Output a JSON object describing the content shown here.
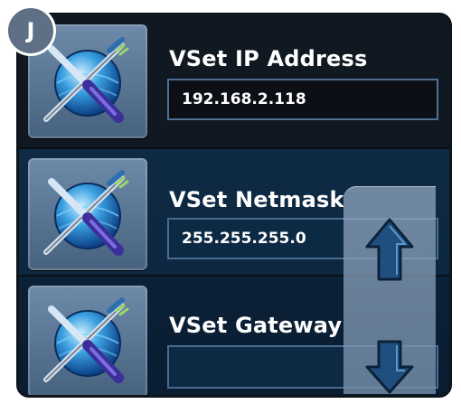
{
  "badge": {
    "letter": "J"
  },
  "settings": [
    {
      "label": "VSet IP Address",
      "value": "192.168.2.118",
      "icon": "network-tools-icon"
    },
    {
      "label": "VSet Netmask",
      "value": "255.255.255.0",
      "icon": "network-tools-icon"
    },
    {
      "label": "VSet Gateway",
      "value": "",
      "icon": "network-tools-icon"
    }
  ],
  "scroll": {
    "up_icon": "arrow-up-icon",
    "down_icon": "arrow-down-icon"
  },
  "colors": {
    "frame": "#0d1117",
    "field_border": "#4f6f93",
    "text": "#ffffff",
    "scroll_panel": "#8ea6c2",
    "arrow_fill": "#1f4f7e"
  }
}
